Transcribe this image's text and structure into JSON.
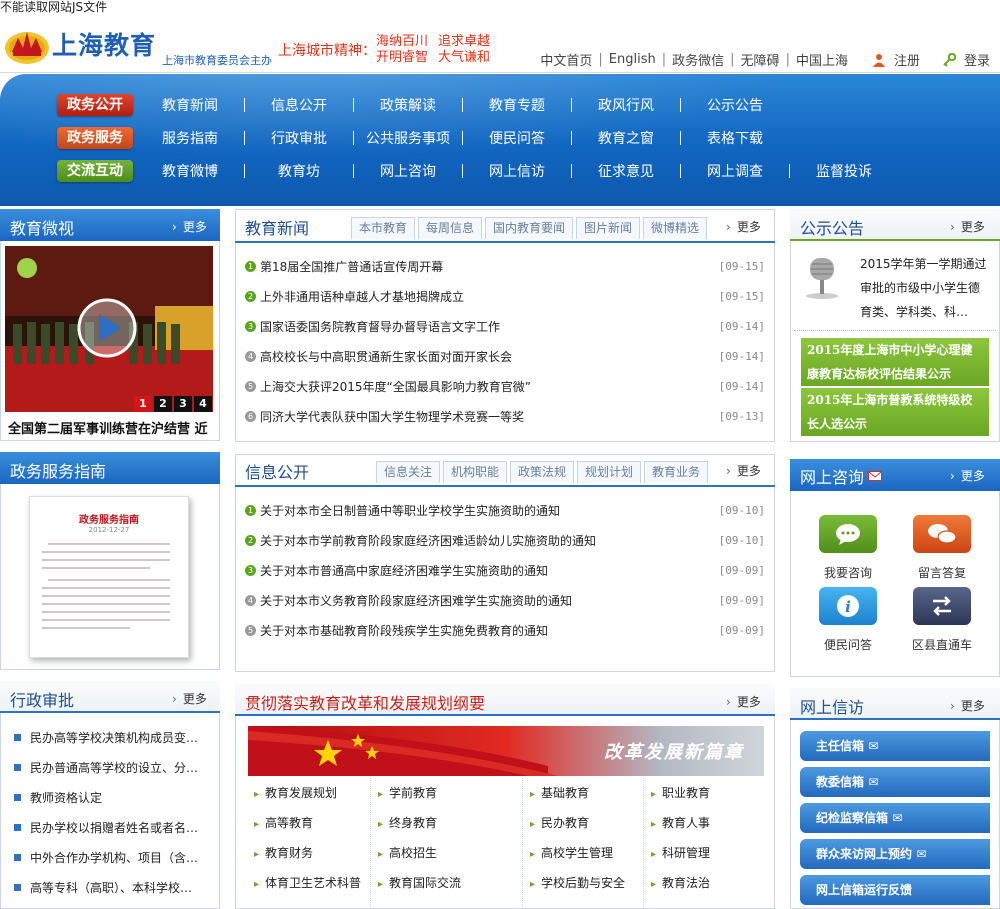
{
  "notice": "不能读取网站JS文件",
  "site": {
    "title": "上海教育",
    "subtitle": "上海市教育委员会主办",
    "spirit_label": "上海城市精神：",
    "spirit_words": [
      "海纳百川",
      "追求卓越",
      "开明睿智",
      "大气谦和"
    ]
  },
  "toplinks": [
    "中文首页",
    "English",
    "政务微信",
    "无障碍",
    "中国上海"
  ],
  "auth": {
    "register": "注册",
    "login": "登录"
  },
  "nav": {
    "rows": [
      {
        "badge": "政务公开",
        "items": [
          "教育新闻",
          "信息公开",
          "政策解读",
          "教育专题",
          "政风行风",
          "公示公告"
        ]
      },
      {
        "badge": "政务服务",
        "items": [
          "服务指南",
          "行政审批",
          "公共服务事项",
          "便民问答",
          "教育之窗",
          "表格下载"
        ]
      },
      {
        "badge": "交流互动",
        "items": [
          "教育微博",
          "教育坊",
          "网上咨询",
          "网上信访",
          "征求意见",
          "网上调查",
          "监督投诉"
        ]
      }
    ]
  },
  "more": "更多",
  "edu_video": {
    "title": "教育微视",
    "caption": "全国第二届军事训练营在沪结营  近",
    "pages": [
      "1",
      "2",
      "3",
      "4"
    ]
  },
  "gov_guide": {
    "title": "政务服务指南",
    "doc_title": "政务服务指南",
    "doc_date": "2012-12-27"
  },
  "admin_approval": {
    "title": "行政审批",
    "items": [
      "民办高等学校决策机构成员变…",
      "民办普通高等学校的设立、分…",
      "教师资格认定",
      "民办学校以捐赠者姓名或者名…",
      "中外合作办学机构、项目（含…",
      "高等专科（高职）、本科学校…"
    ]
  },
  "edu_news": {
    "title": "教育新闻",
    "tabs": [
      "本市教育",
      "每周信息",
      "国内教育要闻",
      "图片新闻",
      "微博精选"
    ],
    "items": [
      {
        "text": "第18届全国推广普通话宣传周开幕",
        "date": "[09-15]"
      },
      {
        "text": "上外非通用语种卓越人才基地揭牌成立",
        "date": "[09-15]"
      },
      {
        "text": "国家语委国务院教育督导办督导语言文字工作",
        "date": "[09-14]"
      },
      {
        "text": "高校校长与中高职贯通新生家长面对面开家长会",
        "date": "[09-14]"
      },
      {
        "text": "上海交大获评2015年度“全国最具影响力教育官微”",
        "date": "[09-14]"
      },
      {
        "text": "同济大学代表队获中国大学生物理学术竞赛一等奖",
        "date": "[09-13]"
      }
    ]
  },
  "info_public": {
    "title": "信息公开",
    "tabs": [
      "信息关注",
      "机构职能",
      "政策法规",
      "规划计划",
      "教育业务"
    ],
    "items": [
      {
        "text": "关于对本市全日制普通中等职业学校学生实施资助的通知",
        "date": "[09-10]"
      },
      {
        "text": "关于对本市学前教育阶段家庭经济困难适龄幼儿实施资助的通知",
        "date": "[09-10]"
      },
      {
        "text": "关于对本市普通高中家庭经济困难学生实施资助的通知",
        "date": "[09-09]"
      },
      {
        "text": "关于对本市义务教育阶段家庭经济困难学生实施资助的通知",
        "date": "[09-09]"
      },
      {
        "text": "关于对本市基础教育阶段残疾学生实施免费教育的通知",
        "date": "[09-09]"
      }
    ]
  },
  "reform": {
    "title": "贯彻落实教育改革和发展规划纲要",
    "banner_text": "改革发展新篇章",
    "links": [
      "教育发展规划",
      "学前教育",
      "基础教育",
      "职业教育",
      "高等教育",
      "终身教育",
      "民办教育",
      "教育人事",
      "教育财务",
      "高校招生",
      "高校学生管理",
      "科研管理",
      "体育卫生艺术科普",
      "教育国际交流",
      "学校后勤与安全",
      "教育法治"
    ]
  },
  "announce": {
    "title": "公示公告",
    "intro": "2015学年第一学期通过审批的市级中小学生德育类、学科类、科…",
    "notes": [
      "2015年度上海市中小学心理健康教育达标校评估结果公示",
      "2015年上海市普教系统特级校长人选公示"
    ]
  },
  "consult": {
    "title": "网上咨询",
    "items": [
      "我要咨询",
      "留言答复",
      "便民问答",
      "区县直通车"
    ],
    "colors": [
      "#5ea424",
      "#e05a1e",
      "#2a9ae0",
      "#3e4b6e"
    ]
  },
  "petition": {
    "title": "网上信访",
    "items": [
      "主任信箱",
      "教委信箱",
      "纪检监察信箱",
      "群众来访网上预约",
      "网上信箱运行反馈"
    ]
  }
}
